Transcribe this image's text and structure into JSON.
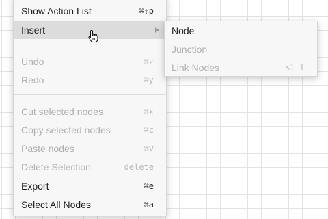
{
  "menu": {
    "items": [
      {
        "label": "Show Action List",
        "shortcut": "⌘⇧p",
        "enabled": true
      },
      {
        "label": "Insert",
        "shortcut": "",
        "enabled": true,
        "submenu": true
      },
      {
        "label": "Undo",
        "shortcut": "⌘z",
        "enabled": false
      },
      {
        "label": "Redo",
        "shortcut": "⌘y",
        "enabled": false
      },
      {
        "label": "Cut selected nodes",
        "shortcut": "⌘x",
        "enabled": false
      },
      {
        "label": "Copy selected nodes",
        "shortcut": "⌘c",
        "enabled": false
      },
      {
        "label": "Paste nodes",
        "shortcut": "⌘v",
        "enabled": false
      },
      {
        "label": "Delete Selection",
        "shortcut": "delete",
        "enabled": false
      },
      {
        "label": "Export",
        "shortcut": "⌘e",
        "enabled": true
      },
      {
        "label": "Select All Nodes",
        "shortcut": "⌘a",
        "enabled": true
      }
    ]
  },
  "submenu": {
    "items": [
      {
        "label": "Node",
        "shortcut": "",
        "enabled": true
      },
      {
        "label": "Junction",
        "shortcut": "",
        "enabled": false
      },
      {
        "label": "Link Nodes",
        "shortcut": "⌥l l",
        "enabled": false
      }
    ]
  },
  "icons": {
    "cursor": "hand-pointer-icon",
    "submenu_arrow": "chevron-right-icon"
  }
}
